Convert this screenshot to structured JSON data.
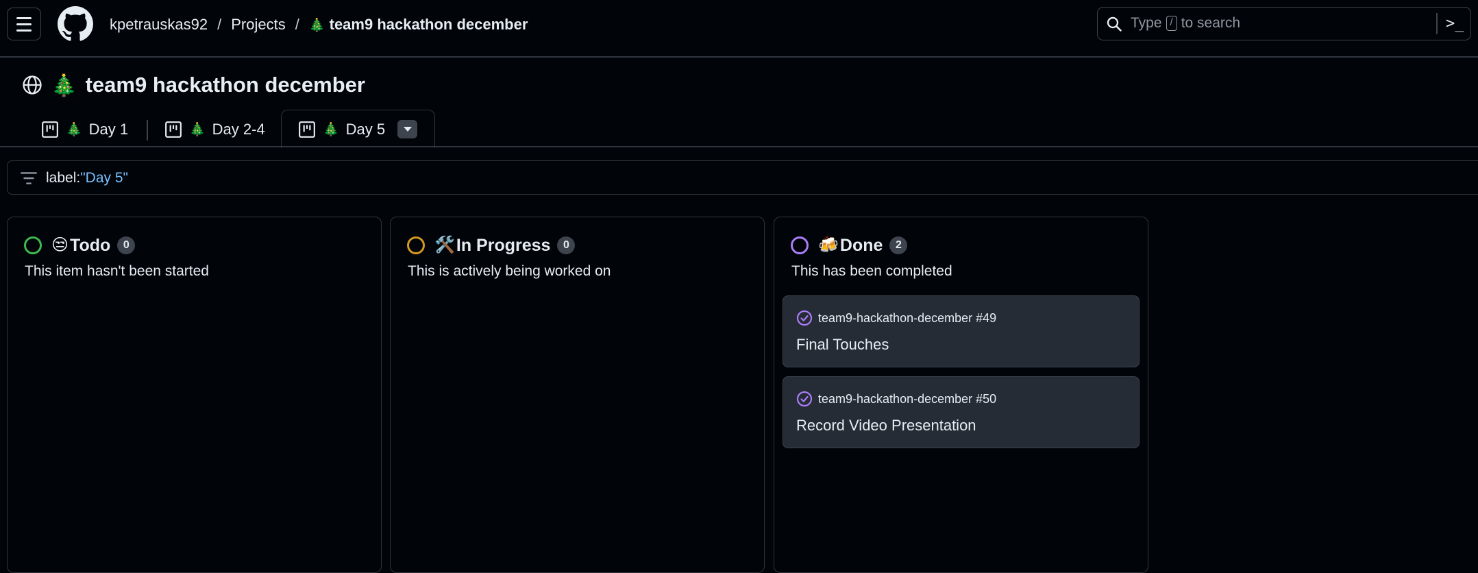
{
  "header": {
    "owner": "kpetrauskas92",
    "projects_label": "Projects",
    "separator": "/",
    "project_name": "team9 hackathon december",
    "project_emoji": "🎄",
    "search_placeholder_prefix": "Type",
    "search_key": "/",
    "search_placeholder_suffix": "to search",
    "command_glyph": ">_"
  },
  "project": {
    "title": "team9 hackathon december",
    "emoji": "🎄",
    "visibility_icon": "globe-icon"
  },
  "tabs": [
    {
      "label": "Day 1",
      "emoji": "🎄",
      "icon": "board-icon",
      "active": false
    },
    {
      "label": "Day 2-4",
      "emoji": "🎄",
      "icon": "board-icon",
      "active": false
    },
    {
      "label": "Day 5",
      "emoji": "🎄",
      "icon": "board-icon",
      "active": true
    }
  ],
  "filter": {
    "key": "label:",
    "value": "\"Day 5\""
  },
  "columns": [
    {
      "title": "Todo",
      "emoji": "😒",
      "count": "0",
      "status_color": "#3fb950",
      "description": "This item hasn't been started",
      "cards": []
    },
    {
      "title": "In Progress",
      "emoji": "🛠️",
      "count": "0",
      "status_color": "#d29922",
      "description": "This is actively being worked on",
      "cards": []
    },
    {
      "title": "Done",
      "emoji": "🍻",
      "count": "2",
      "status_color": "#ab7df8",
      "description": "This has been completed",
      "cards": [
        {
          "repo_ref": "team9-hackathon-december #49",
          "title": "Final Touches"
        },
        {
          "repo_ref": "team9-hackathon-december #50",
          "title": "Record Video Presentation"
        }
      ]
    }
  ],
  "colors": {
    "background": "#010409",
    "border": "#30363d",
    "card_bg": "#262c36",
    "done_purple": "#ab7df8",
    "filter_value": "#79c0ff"
  }
}
